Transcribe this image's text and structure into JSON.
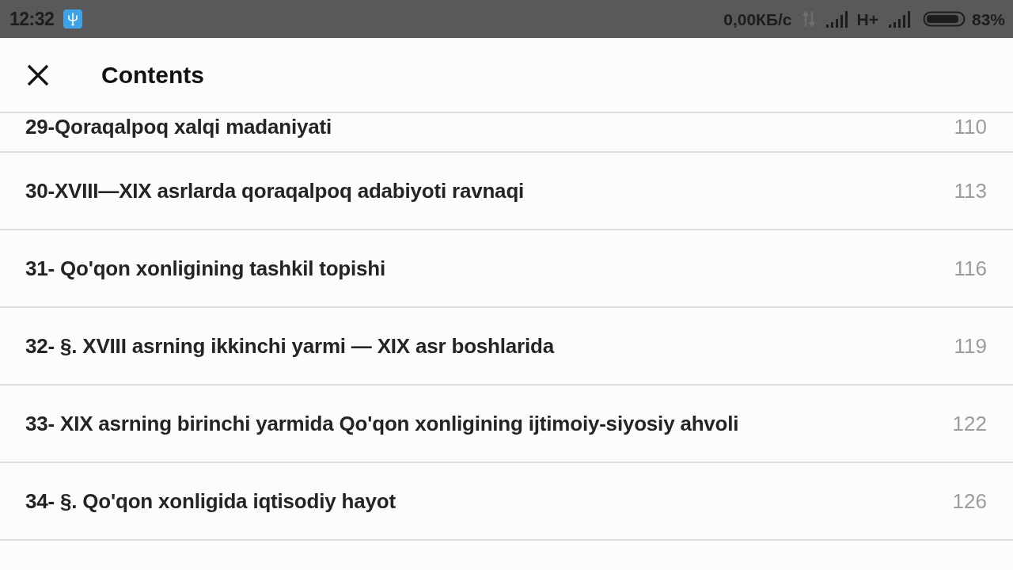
{
  "status_bar": {
    "time": "12:32",
    "speed": "0,00КБ/с",
    "network": "H+",
    "battery": "83%"
  },
  "header": {
    "title": "Contents"
  },
  "entries": [
    {
      "title": "29-Qoraqalpoq xalqi madaniyati",
      "page": "110"
    },
    {
      "title": "30-XVIII—XIX asrlarda qoraqalpoq adabiyoti ravnaqi",
      "page": "113"
    },
    {
      "title": "31- Qo'qon xonligining tashkil topishi",
      "page": "116"
    },
    {
      "title": "32- §. XVIII asrning ikkinchi yarmi — XIX asr boshlarida",
      "page": "119"
    },
    {
      "title": "33- XIX asrning birinchi yarmida Qo'qon xonligining ijtimoiy-siyosiy ahvoli",
      "page": "122"
    },
    {
      "title": "34- §. Qo'qon xonligida iqtisodiy hayot",
      "page": "126"
    }
  ]
}
